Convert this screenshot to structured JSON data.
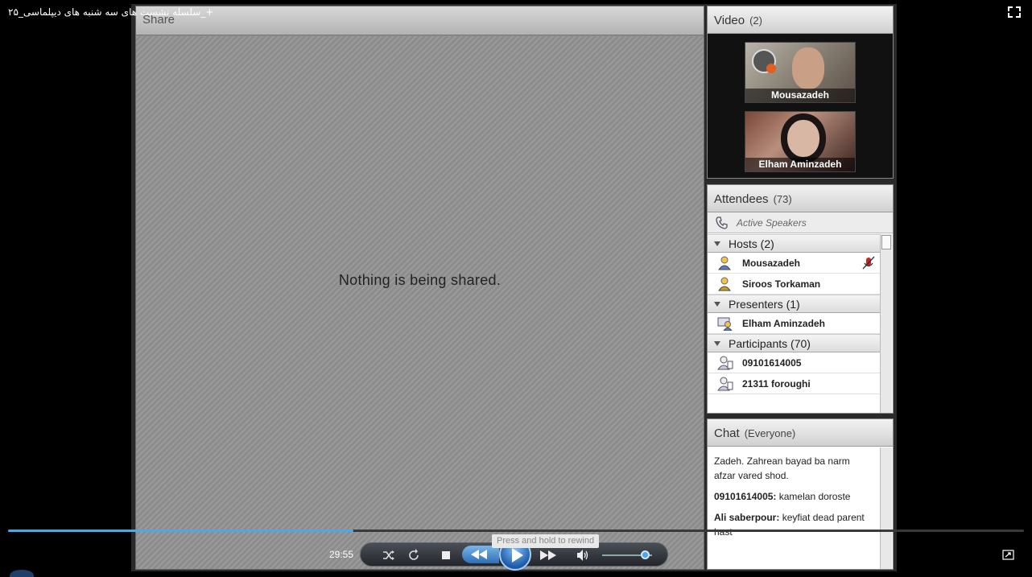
{
  "window": {
    "title": "سلسله نشست های سه شنبه های دیپلماسی_۲۵_+"
  },
  "share": {
    "header": "Share",
    "message": "Nothing is being shared."
  },
  "video": {
    "title": "Video",
    "count": "(2)",
    "tiles": [
      {
        "name": "Mousazadeh"
      },
      {
        "name": "Elham Aminzadeh"
      }
    ]
  },
  "attendees": {
    "title": "Attendees",
    "count": "(73)",
    "active_speakers": "Active Speakers",
    "hosts_label": "Hosts (2)",
    "hosts": [
      "Mousazadeh",
      "Siroos Torkaman"
    ],
    "presenters_label": "Presenters (1)",
    "presenters": [
      "Elham Aminzadeh"
    ],
    "participants_label": "Participants (70)",
    "participants": [
      "09101614005",
      "21311 foroughi"
    ]
  },
  "chat": {
    "title": "Chat",
    "scope": "(Everyone)",
    "messages": [
      {
        "sender": "",
        "text": "Zadeh. Zahrean bayad ba narm afzar vared shod."
      },
      {
        "sender": "09101614005:",
        "text": " kamelan doroste"
      },
      {
        "sender": "Ali saberpour:",
        "text": " keyfiat dead parent hast"
      }
    ]
  },
  "player": {
    "time": "29:55",
    "tooltip": "Press and hold to rewind",
    "progress": 0.34,
    "volume": 0.85,
    "accent": "#4ea7e8"
  }
}
